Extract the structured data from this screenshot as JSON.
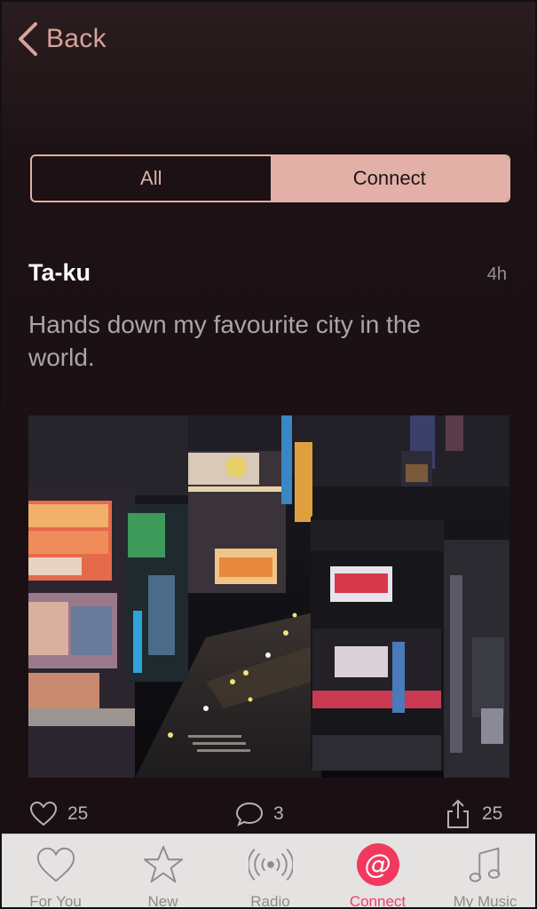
{
  "nav": {
    "back_label": "Back"
  },
  "segmented": {
    "all_label": "All",
    "connect_label": "Connect",
    "selected": "Connect"
  },
  "post": {
    "author": "Ta-ku",
    "time": "4h",
    "text": "Hands down my favourite city in the world.",
    "likes": "25",
    "comments": "3",
    "shares": "25"
  },
  "tabbar": {
    "items": [
      {
        "label": "For You",
        "icon": "heart-icon"
      },
      {
        "label": "New",
        "icon": "star-icon"
      },
      {
        "label": "Radio",
        "icon": "radio-waves-icon"
      },
      {
        "label": "Connect",
        "icon": "at-sign-icon",
        "active": true
      },
      {
        "label": "My Music",
        "icon": "music-note-icon"
      }
    ]
  },
  "colors": {
    "accent": "#e2b0a6",
    "active_tab": "#ee3f67",
    "background": "#1a1013"
  }
}
